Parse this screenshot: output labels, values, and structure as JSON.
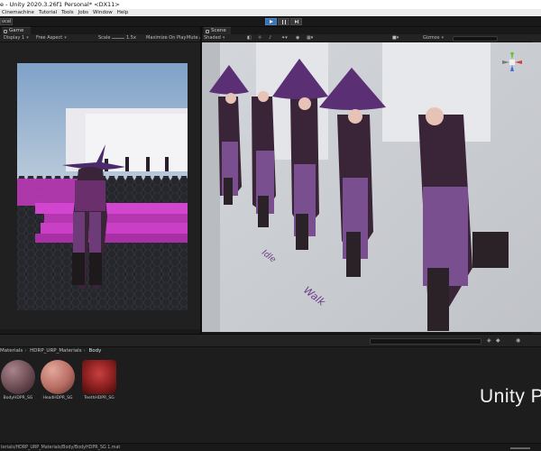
{
  "window": {
    "title": "e - Unity 2020.3.26f1 Personal* <DX11>"
  },
  "menu": {
    "items": [
      "Cinemachine",
      "Tutorial",
      "Tools",
      "Jobs",
      "Window",
      "Help"
    ]
  },
  "toolbar": {
    "left_button": "ocal",
    "play_icons": [
      "play-icon",
      "pause-icon",
      "step-icon"
    ]
  },
  "game_panel": {
    "tab_label": "Game",
    "display": "Display 1",
    "aspect": "Free Aspect",
    "scale_label": "Scale",
    "scale_value": "1.5x",
    "maximize": "Maximize On Play",
    "mute": "Mute A"
  },
  "scene_panel": {
    "tab_label": "Scene",
    "shading": "Shaded",
    "gizmos": "Gizmos",
    "floor_labels": [
      "Idle",
      "Walk"
    ]
  },
  "project_panel": {
    "breadcrumb": [
      "Materials",
      "HDRP_URP_Materials",
      "Body"
    ],
    "assets": [
      {
        "label": "BodyHDPR_SG",
        "color": "#6b4a52"
      },
      {
        "label": "HeadHDPR_SG",
        "color": "#b86c62"
      },
      {
        "label": "TeethHDPR_SG",
        "color": "#8a1e1e"
      }
    ],
    "status_path": "terials/HDRP_URP_Materials/Body/BodyHDPR_SG 1.mat"
  },
  "overlay": {
    "watermark": "Unity P"
  }
}
